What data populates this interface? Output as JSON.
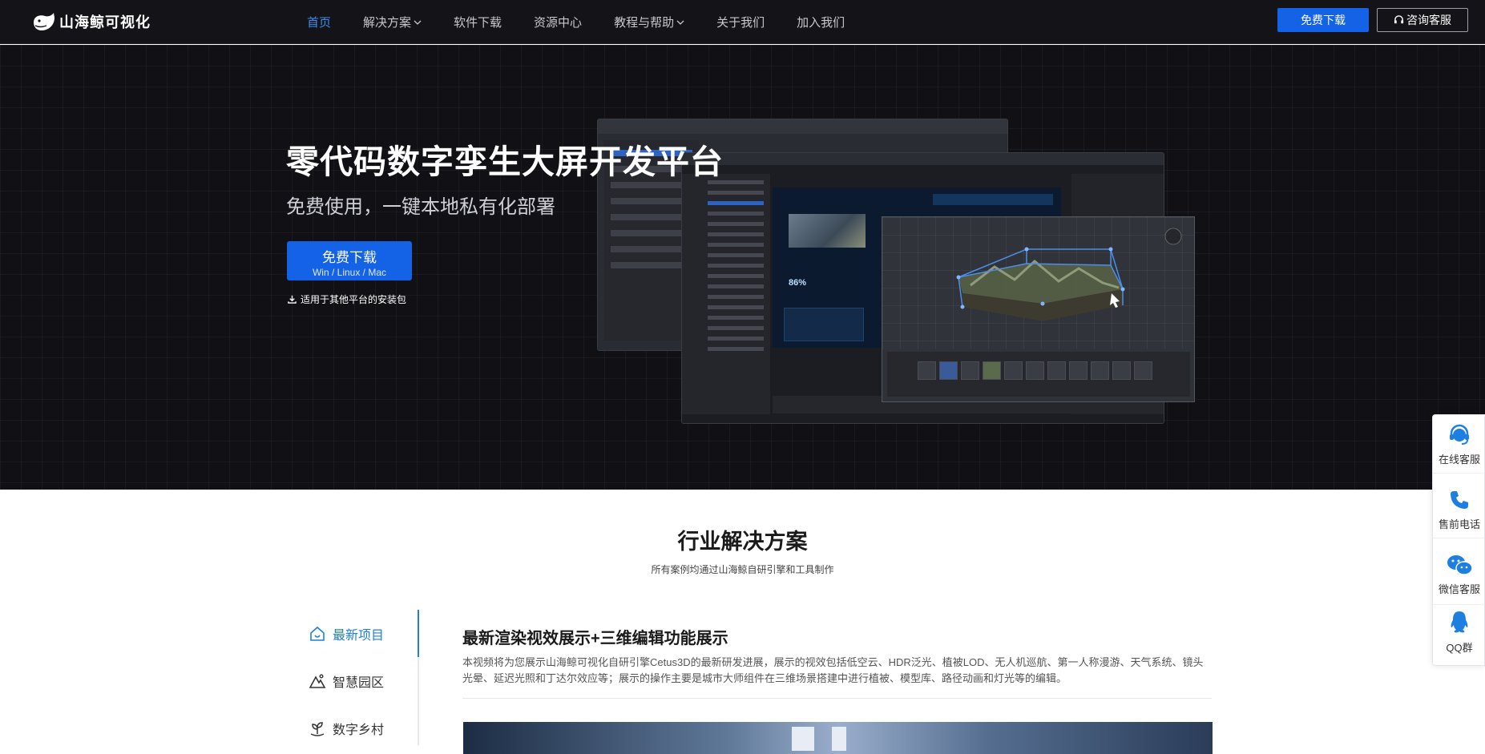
{
  "brand": {
    "name": "山海鲸可视化"
  },
  "nav": {
    "items": [
      {
        "label": "首页",
        "active": true,
        "has_dropdown": false
      },
      {
        "label": "解决方案",
        "active": false,
        "has_dropdown": true
      },
      {
        "label": "软件下载",
        "active": false,
        "has_dropdown": false
      },
      {
        "label": "资源中心",
        "active": false,
        "has_dropdown": false
      },
      {
        "label": "教程与帮助",
        "active": false,
        "has_dropdown": true
      },
      {
        "label": "关于我们",
        "active": false,
        "has_dropdown": false
      },
      {
        "label": "加入我们",
        "active": false,
        "has_dropdown": false
      }
    ],
    "download_label": "免费下载",
    "consult_label": "咨询客服"
  },
  "hero": {
    "title": "零代码数字孪生大屏开发平台",
    "subtitle": "免费使用，一键本地私有化部署",
    "button_main": "免费下载",
    "button_sub": "Win / Linux / Mac",
    "other_platforms": "适用于其他平台的安装包",
    "mockup_percent": "86%",
    "slides": 2,
    "active_slide": 1
  },
  "solutions": {
    "title": "行业解决方案",
    "subtitle": "所有案例均通过山海鲸自研引擎和工具制作",
    "tabs": [
      {
        "label": "最新项目",
        "icon": "home-icon",
        "active": true
      },
      {
        "label": "智慧园区",
        "icon": "mountain-icon",
        "active": false
      },
      {
        "label": "数字乡村",
        "icon": "sprout-icon",
        "active": false
      }
    ],
    "case_title": "最新渲染视效展示+三维编辑功能展示",
    "case_desc": "本视频将为您展示山海鲸可视化自研引擎Cetus3D的最新研发进展，展示的视效包括低空云、HDR泛光、植被LOD、无人机巡航、第一人称漫游、天气系统、镜头光晕、延迟光照和丁达尔效应等；展示的操作主要是城市大师组件在三维场景搭建中进行植被、模型库、路径动画和灯光等的编辑。"
  },
  "float_bar": {
    "items": [
      {
        "label": "在线客服",
        "icon": "headset-icon"
      },
      {
        "label": "售前电话",
        "icon": "phone-icon"
      },
      {
        "label": "微信客服",
        "icon": "wechat-icon"
      },
      {
        "label": "QQ群",
        "icon": "qq-icon"
      }
    ]
  },
  "colors": {
    "accent": "#1463e6",
    "active_link": "#3b8cf0",
    "hero_bg": "#101015"
  }
}
